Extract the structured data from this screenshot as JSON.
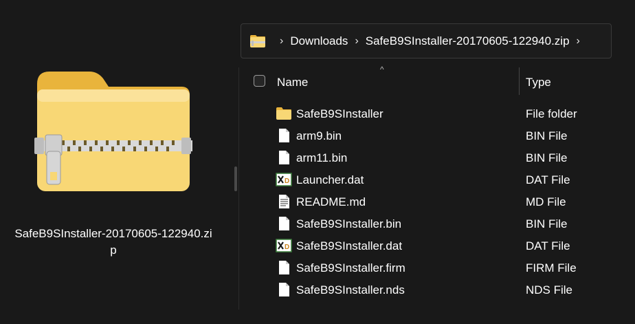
{
  "preview": {
    "file_name": "SafeB9SInstaller-20170605-122940.zip",
    "icon": "zip-folder-icon"
  },
  "address_bar": {
    "icon": "zip-folder-icon",
    "crumbs": [
      "Downloads",
      "SafeB9SInstaller-20170605-122940.zip"
    ],
    "separator": "›"
  },
  "columns": {
    "name": "Name",
    "type": "Type",
    "sort_indicator": "^"
  },
  "files": [
    {
      "name": "SafeB9SInstaller",
      "type": "File folder",
      "icon": "folder-icon"
    },
    {
      "name": "arm9.bin",
      "type": "BIN File",
      "icon": "blank-file-icon"
    },
    {
      "name": "arm11.bin",
      "type": "BIN File",
      "icon": "blank-file-icon"
    },
    {
      "name": "Launcher.dat",
      "type": "DAT File",
      "icon": "dat-file-icon"
    },
    {
      "name": "README.md",
      "type": "MD File",
      "icon": "text-file-icon"
    },
    {
      "name": "SafeB9SInstaller.bin",
      "type": "BIN File",
      "icon": "blank-file-icon"
    },
    {
      "name": "SafeB9SInstaller.dat",
      "type": "DAT File",
      "icon": "dat-file-icon"
    },
    {
      "name": "SafeB9SInstaller.firm",
      "type": "FIRM File",
      "icon": "blank-file-icon"
    },
    {
      "name": "SafeB9SInstaller.nds",
      "type": "NDS File",
      "icon": "blank-file-icon"
    }
  ],
  "colors": {
    "background": "#191919",
    "folder_yellow": "#f8d775",
    "folder_dark": "#e8b23a"
  }
}
